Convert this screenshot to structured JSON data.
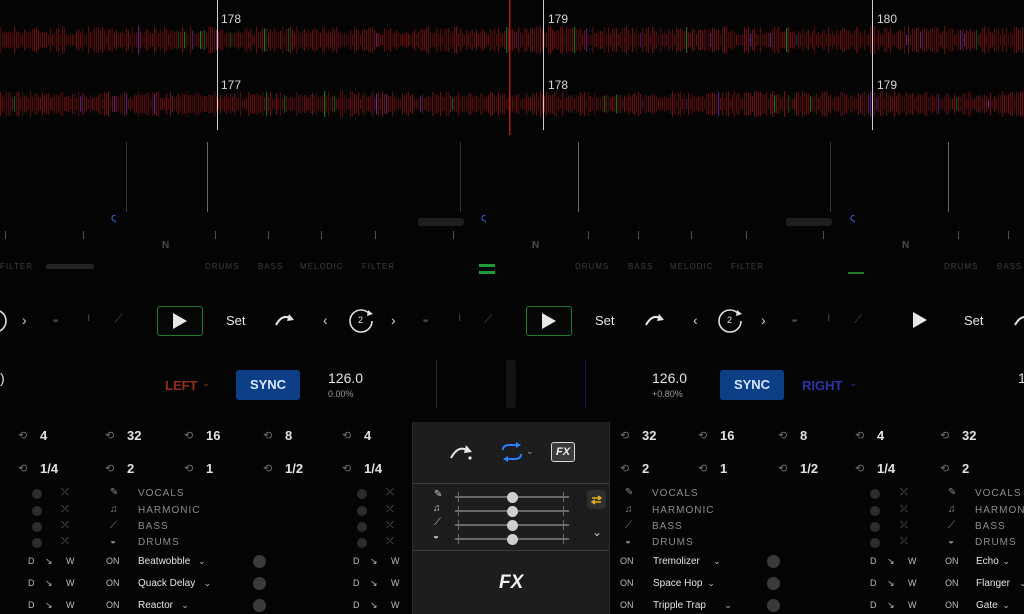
{
  "beat_markers": {
    "top": [
      "178",
      "179",
      "180"
    ],
    "bottom": [
      "177",
      "178",
      "179"
    ]
  },
  "deck_controls": {
    "stem_labels_left": [
      "FILTER",
      "DRUMS",
      "BASS",
      "MELODIC",
      "FILTER"
    ],
    "stem_labels_mid": [
      "DRUMS",
      "BASS",
      "MELODIC",
      "FILTER"
    ],
    "stem_labels_right": [
      "DRUMS",
      "BASS"
    ],
    "n_label": "N",
    "set_label": "Set",
    "loop_count": "2"
  },
  "left_deck": {
    "label": "LEFT",
    "sync_label": "SYNC",
    "bpm": "126.0",
    "pitch": "0.00%"
  },
  "right_deck": {
    "label": "RIGHT",
    "sync_label": "SYNC",
    "bpm": "126.0",
    "pitch": "+0.80%"
  },
  "loops_row1": [
    "4",
    "32",
    "16",
    "8",
    "4",
    "32",
    "16",
    "8",
    "4",
    "32"
  ],
  "loops_row2": [
    "1/4",
    "2",
    "1",
    "1/2",
    "1/4",
    "2",
    "1",
    "1/2",
    "1/4",
    "2"
  ],
  "stems": [
    "VOCALS",
    "HARMONIC",
    "BASS",
    "DRUMS"
  ],
  "fx_left": {
    "on": "ON",
    "d": "D",
    "w": "W",
    "effects": [
      "Beatwobble",
      "Quack Delay",
      "Reactor"
    ]
  },
  "fx_mid": {
    "on": "ON",
    "effects": [
      "Tremolizer",
      "Space Hop",
      "Tripple Trap"
    ]
  },
  "fx_right": {
    "on": "ON",
    "effects": [
      "Echo",
      "Flanger",
      "Gate"
    ]
  },
  "popup": {
    "fx_badge": "FX",
    "fx_large": "FX",
    "stem_slider_levels": [
      0.5,
      0.5,
      0.5,
      0.5
    ]
  },
  "colors": {
    "sync_blue": "#0c3f86",
    "left_accent": "#c0401f",
    "right_accent": "#3a3fd0",
    "play_border": "#1f7a2a",
    "loop_blue": "#2f7dff",
    "waveform_red": "#7a1414"
  }
}
